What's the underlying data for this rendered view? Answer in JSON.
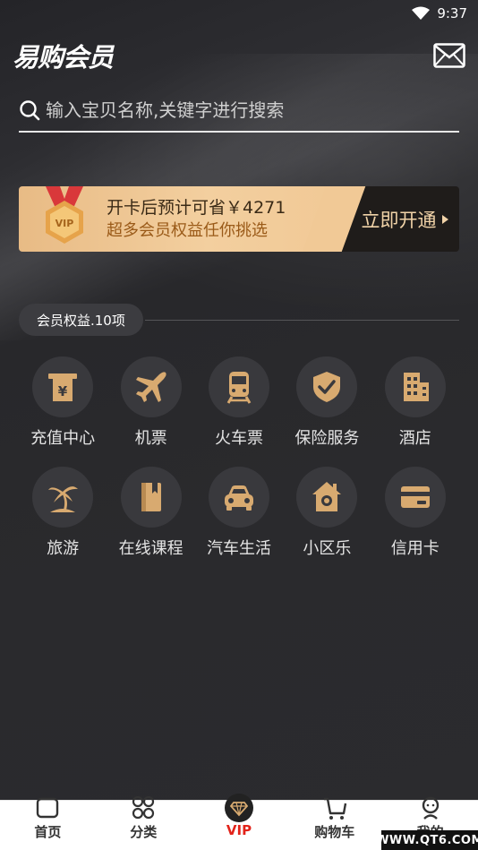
{
  "status_bar": {
    "time": "9:37"
  },
  "header": {
    "logo_text": "易购会员"
  },
  "search": {
    "placeholder": "输入宝贝名称,关键字进行搜索"
  },
  "banner": {
    "line1": "开卡后预计可省￥4271",
    "line2": "超多会员权益任你挑选",
    "cta": "立即开通"
  },
  "section": {
    "title": "会员权益.10项"
  },
  "benefits": [
    {
      "label": "充值中心",
      "icon": "recharge-icon"
    },
    {
      "label": "机票",
      "icon": "airplane-icon"
    },
    {
      "label": "火车票",
      "icon": "train-icon"
    },
    {
      "label": "保险服务",
      "icon": "shield-check-icon"
    },
    {
      "label": "酒店",
      "icon": "building-icon"
    },
    {
      "label": "旅游",
      "icon": "palm-tree-icon"
    },
    {
      "label": "在线课程",
      "icon": "book-icon"
    },
    {
      "label": "汽车生活",
      "icon": "car-icon"
    },
    {
      "label": "小区乐",
      "icon": "home-icon"
    },
    {
      "label": "信用卡",
      "icon": "credit-card-icon"
    }
  ],
  "bottom_nav": [
    {
      "label": "首页",
      "icon": "home-tab-icon"
    },
    {
      "label": "分类",
      "icon": "category-icon"
    },
    {
      "label": "VIP",
      "icon": "diamond-icon",
      "active": true
    },
    {
      "label": "购物车",
      "icon": "cart-icon"
    },
    {
      "label": "我的",
      "icon": "profile-icon"
    }
  ],
  "watermark": "WWW.QT6.COM",
  "colors": {
    "gold": "#d8aa70",
    "accent_red": "#e2231a",
    "bg": "#2a2a2d"
  }
}
